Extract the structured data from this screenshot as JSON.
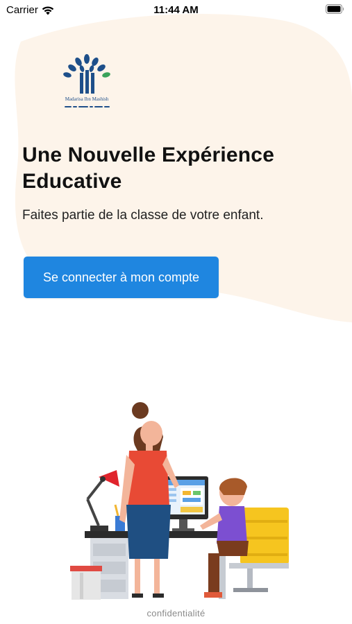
{
  "status_bar": {
    "carrier": "Carrier",
    "time": "11:44 AM"
  },
  "logo": {
    "caption": "Madarisa Ibn Mashish",
    "brand_color": "#1e4f8a",
    "leaf_accent": "#3aa35a"
  },
  "hero": {
    "headline": "Une Nouvelle Expérience Educative",
    "subtitle": "Faites partie de la classe de votre enfant."
  },
  "actions": {
    "login_button": "Se connecter à mon compte",
    "button_color": "#1f86e0"
  },
  "footer": {
    "privacy_link": "confidentialité"
  },
  "colors": {
    "background_blob": "#fdf4ea"
  }
}
